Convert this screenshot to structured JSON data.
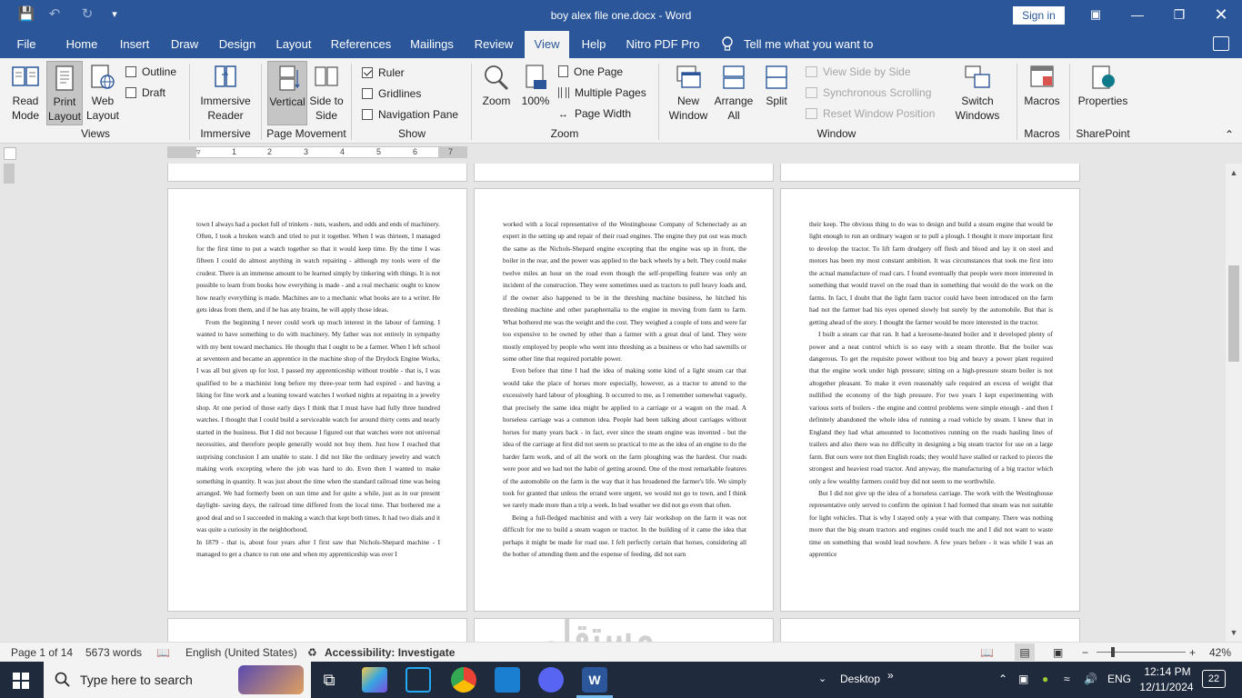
{
  "window": {
    "title": "boy alex file one.docx  -  Word",
    "sign_in": "Sign in"
  },
  "menu": {
    "tabs": [
      "File",
      "Home",
      "Insert",
      "Draw",
      "Design",
      "Layout",
      "References",
      "Mailings",
      "Review",
      "View",
      "Help",
      "Nitro PDF Pro"
    ],
    "active": "View",
    "tell_me": "Tell me what you want to do"
  },
  "ribbon": {
    "views": {
      "read_mode": "Read Mode",
      "print_layout": "Print Layout",
      "web_layout": "Web Layout",
      "outline": "Outline",
      "draft": "Draft",
      "label": "Views"
    },
    "immersive": {
      "immersive_reader": "Immersive Reader",
      "label": "Immersive"
    },
    "page_movement": {
      "vertical": "Vertical",
      "side_to_side": "Side to Side",
      "label": "Page Movement"
    },
    "show": {
      "ruler": "Ruler",
      "gridlines": "Gridlines",
      "navigation_pane": "Navigation Pane",
      "label": "Show",
      "ruler_checked": true,
      "gridlines_checked": false,
      "nav_checked": false
    },
    "zoom": {
      "zoom": "Zoom",
      "hundred": "100%",
      "one_page": "One Page",
      "multiple_pages": "Multiple Pages",
      "page_width": "Page Width",
      "label": "Zoom"
    },
    "window": {
      "new_window": "New Window",
      "arrange_all": "Arrange All",
      "split": "Split",
      "view_side_by_side": "View Side by Side",
      "synchronous_scrolling": "Synchronous Scrolling",
      "reset_window_position": "Reset Window Position",
      "switch_windows": "Switch Windows",
      "label": "Window"
    },
    "macros": {
      "macros": "Macros",
      "label": "Macros"
    },
    "sharepoint": {
      "properties": "Properties",
      "label": "SharePoint"
    }
  },
  "ruler": {
    "ticks": [
      "1",
      "1",
      "2",
      "3",
      "4",
      "5",
      "6",
      "7"
    ]
  },
  "pages": [
    {
      "paragraphs": [
        {
          "text": "town I always had a pocket full of trinkets - nuts, washers, and odds and ends of machinery. Often, I took a broken watch and tried to put it together. When I was thirteen, I managed for the first time to put a watch together so that it would keep time. By the time I was fifteen I could do almost anything in watch repairing - although my tools were of the crudest. There is an immense amount to be learned simply by tinkering with things. It is not possible to learn from books how everything is made - and a real mechanic ought to know how nearly everything is made. Machines are to a mechanic what books are to a writer. He gets ideas from them, and if he has any brains, he will apply those ideas.",
          "indent": false
        },
        {
          "text": "From the beginning I never could work up much interest in the labour of farming. I wanted to have something to do with machinery. My father was not entirely in sympathy with my bent toward mechanics. He thought that I ought to be a farmer. When I left school at seventeen and became an apprentice in the machine shop of the Drydock Engine Works, I was all but given up for lost. I passed my apprenticeship without trouble - that is, I was qualified to be a machinist long before my three-year term had expired - and having a liking for fine work and a leaning toward watches I worked nights at repairing in a jewelry shop. At one period of those early days I think that I must have had fully three hundred watches. I thought that I could build a serviceable watch for around thirty cents and nearly started in the business. But I did not because I figured out that watches were not universal necessities, and therefore people generally would not buy them. Just how I reached that surprising conclusion I am unable to state. I did not like the ordinary jewelry and watch making work excepting where the job was hard to do. Even then I wanted to make something in quantity. It was just about the time when the standard railroad time was being arranged. We had formerly been on sun time and for quite a while, just as in our present daylight- saving days, the railroad time differed from the local time. That bothered me a good deal and so I succeeded in making a watch that kept both times. It had two dials and it was quite a curiosity in the neighborhood.",
          "indent": true
        },
        {
          "text": "In 1879 - that is, about four years after I first saw that Nichols-Shepard machine - I managed to get a chance to run one and when my apprenticeship was over I",
          "indent": false
        }
      ]
    },
    {
      "paragraphs": [
        {
          "text": "worked with a local representative of the Westinghouse Company of Schenectady as an expert in the setting up and repair of their road engines. The engine they put out was much the same as the Nichols-Shepard engine excepting that the engine was up in front, the boiler in the rear, and the power was applied to the back wheels by a belt. They could make twelve miles an hour on the road even though the self-propelling feature was only an incident of the construction. They were sometimes used as tractors to pull heavy loads and, if the owner also happened to be in the threshing machine business, he hitched his threshing machine and other paraphernalia to the engine in moving from farm to farm. What bothered me was the weight and the cost. They weighed a couple of tons and were far too expensive to be owned by other than a farmer with a great deal of land. They were mostly employed by people who went into threshing as a business or who had sawmills or some other line that required portable power.",
          "indent": false
        },
        {
          "text": "Even before that time I had the idea of making some kind of a light steam car that would take the place of horses more especially, however, as a tractor to attend to the excessively hard labour of ploughing. It occurred to me, as I remember somewhat vaguely, that precisely the same idea might be applied to a carriage or a wagon on the road. A horseless carriage was a common idea. People had been talking about carriages without horses for many years back - in fact, ever since the steam engine was invented - but the idea of the carriage at first did not seem so practical to me as the idea of an engine to do the harder farm work, and of all the work on the farm ploughing was the hardest. Our roads were poor and we had not the habit of getting around. One of the most remarkable features of the automobile on the farm is the way that it has broadened the farmer's life. We simply took for granted that unless the errand were urgent, we would not go to town, and I think we rarely made more than a trip a week. In bad weather we did not go even that often.",
          "indent": true
        },
        {
          "text": "Being a full-fledged machinist and with a very fair workshop on the farm it was not difficult for me to build a steam wagon or tractor. In the building of it came the idea that perhaps it might be made for road use. I felt perfectly certain that horses, considering all the bother of attending them and the expense of feeding, did not earn",
          "indent": true
        }
      ]
    },
    {
      "paragraphs": [
        {
          "text": "their keep. The obvious thing to do was to design and build a steam engine that would be light enough to run an ordinary wagon or to pull a plough. I thought it more important first to develop the tractor. To lift farm drudgery off flesh and blood and lay it on steel and motors has been my most constant ambition. It was circumstances that took me first into the actual manufacture of road cars. I found eventually that people were more interested in something that would travel on the road than in something that would do the work on the farms. In fact, I doubt that the light farm tractor could have been introduced on the farm had not the farmer had his eyes opened slowly but surely by the automobile. But that is getting ahead of the story. I thought the farmer would be more interested in the tractor.",
          "indent": false
        },
        {
          "text": "I built a steam car that ran. It had a kerosene-heated boiler and it developed plenty of power and a neat control which is so easy with a steam throttle. But the boiler was dangerous. To get the requisite power without too big and heavy a power plant required that the engine work under high pressure; sitting on a high-pressure steam boiler is not altogether pleasant. To make it even reasonably safe required an excess of weight that nullified the economy of the high pressure. For two years I kept experimenting with various sorts of boilers - the engine and control problems were simple enough - and then I definitely abandoned the whole idea of running a road vehicle by steam. I knew that in England they had what amounted to locomotives running on the roads hauling lines of trailers and also there was no difficulty in designing a big steam tractor for use on a large farm. But ours were not then English roads; they would have stalled or racked to pieces the strongest and heaviest road tractor. And anyway, the manufacturing of a big tractor which only a few wealthy farmers could buy did not seem to me worthwhile.",
          "indent": true
        },
        {
          "text": "But I did not give up the idea of a horseless carriage. The work with the Westinghouse representative only served to confirm the opinion I had formed that steam was not suitable for light vehicles. That is why I stayed only a year with that company. There was nothing more that the big steam tractors and engines could teach me and I did not want to waste time on something that would lead nowhere. A few years before - it was while I was an apprentice",
          "indent": true
        }
      ]
    }
  ],
  "status": {
    "page": "Page 1 of 14",
    "words": "5673 words",
    "language": "English (United States)",
    "accessibility": "Accessibility: Investigate",
    "zoom": "42%",
    "zoom_level_percent": 42
  },
  "taskbar": {
    "search": "Type here to search",
    "desktop": "Desktop",
    "lang": "ENG",
    "time": "12:14 PM",
    "date": "12/11/2024",
    "notif_count": "22"
  },
  "colors": {
    "word_blue": "#2b579a",
    "taskbar": "#1f2a3c",
    "ribbon": "#f3f3f3"
  }
}
